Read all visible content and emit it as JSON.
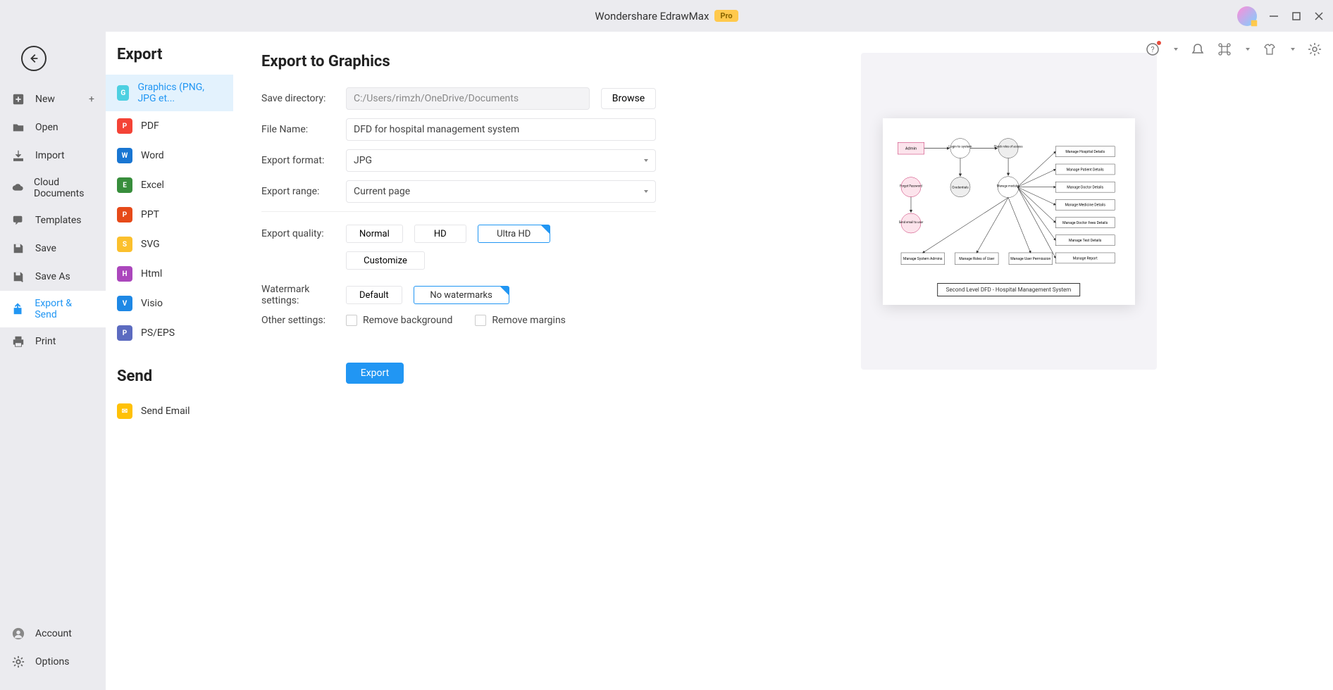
{
  "app": {
    "title": "Wondershare EdrawMax",
    "pro_badge": "Pro"
  },
  "window_controls": {
    "min": "—",
    "max": "▢",
    "close": "✕"
  },
  "sidebar1": {
    "items": [
      {
        "label": "New",
        "icon": "plus-square",
        "has_plus": true
      },
      {
        "label": "Open",
        "icon": "folder"
      },
      {
        "label": "Import",
        "icon": "download"
      },
      {
        "label": "Cloud Documents",
        "icon": "cloud"
      },
      {
        "label": "Templates",
        "icon": "chat"
      },
      {
        "label": "Save",
        "icon": "save"
      },
      {
        "label": "Save As",
        "icon": "save-as"
      },
      {
        "label": "Export & Send",
        "icon": "export",
        "active": true
      },
      {
        "label": "Print",
        "icon": "print"
      }
    ],
    "bottom": [
      {
        "label": "Account",
        "icon": "person"
      },
      {
        "label": "Options",
        "icon": "gear"
      }
    ]
  },
  "sidebar2": {
    "export_heading": "Export",
    "send_heading": "Send",
    "formats": [
      {
        "label": "Graphics (PNG, JPG et...",
        "color": "#4dd0e1",
        "active": true
      },
      {
        "label": "PDF",
        "color": "#f44336"
      },
      {
        "label": "Word",
        "color": "#1976d2"
      },
      {
        "label": "Excel",
        "color": "#388e3c"
      },
      {
        "label": "PPT",
        "color": "#e64a19"
      },
      {
        "label": "SVG",
        "color": "#fbc02d"
      },
      {
        "label": "Html",
        "color": "#ab47bc"
      },
      {
        "label": "Visio",
        "color": "#1e88e5"
      },
      {
        "label": "PS/EPS",
        "color": "#5c6bc0"
      }
    ],
    "send_items": [
      {
        "label": "Send Email",
        "color": "#ffc107"
      }
    ]
  },
  "form": {
    "heading": "Export to Graphics",
    "labels": {
      "save_directory": "Save directory:",
      "file_name": "File Name:",
      "export_format": "Export format:",
      "export_range": "Export range:",
      "export_quality": "Export quality:",
      "watermark": "Watermark settings:",
      "other": "Other settings:"
    },
    "values": {
      "save_directory": "C:/Users/rimzh/OneDrive/Documents",
      "file_name": "DFD for hospital management system",
      "export_format": "JPG",
      "export_range": "Current page"
    },
    "browse": "Browse",
    "quality_options": [
      "Normal",
      "HD",
      "Ultra HD"
    ],
    "quality_selected": "Ultra HD",
    "customize": "Customize",
    "watermark_options": [
      "Default",
      "No watermarks"
    ],
    "watermark_selected": "No watermarks",
    "other_options": [
      "Remove background",
      "Remove margins"
    ],
    "export_btn": "Export"
  },
  "preview": {
    "dfd_title": "Second Level DFD - Hospital Management System",
    "nodes": {
      "admin": "Admin",
      "login": "Login to system",
      "check_roles": "Check roles of access",
      "forgot": "Forgot Password",
      "credentials": "Credentials",
      "manage_modules": "Manage modules",
      "send_email": "Send email to user",
      "row1": [
        "Manage System Admins",
        "Manage Roles of User",
        "Manage User Permission"
      ],
      "rights": [
        "Manage Hospital Details",
        "Manage Patient Details",
        "Manage Doctor Details",
        "Manage Medicine Details",
        "Manage Doctor Fees Details",
        "Manage Test Details",
        "Manage Report"
      ]
    }
  }
}
